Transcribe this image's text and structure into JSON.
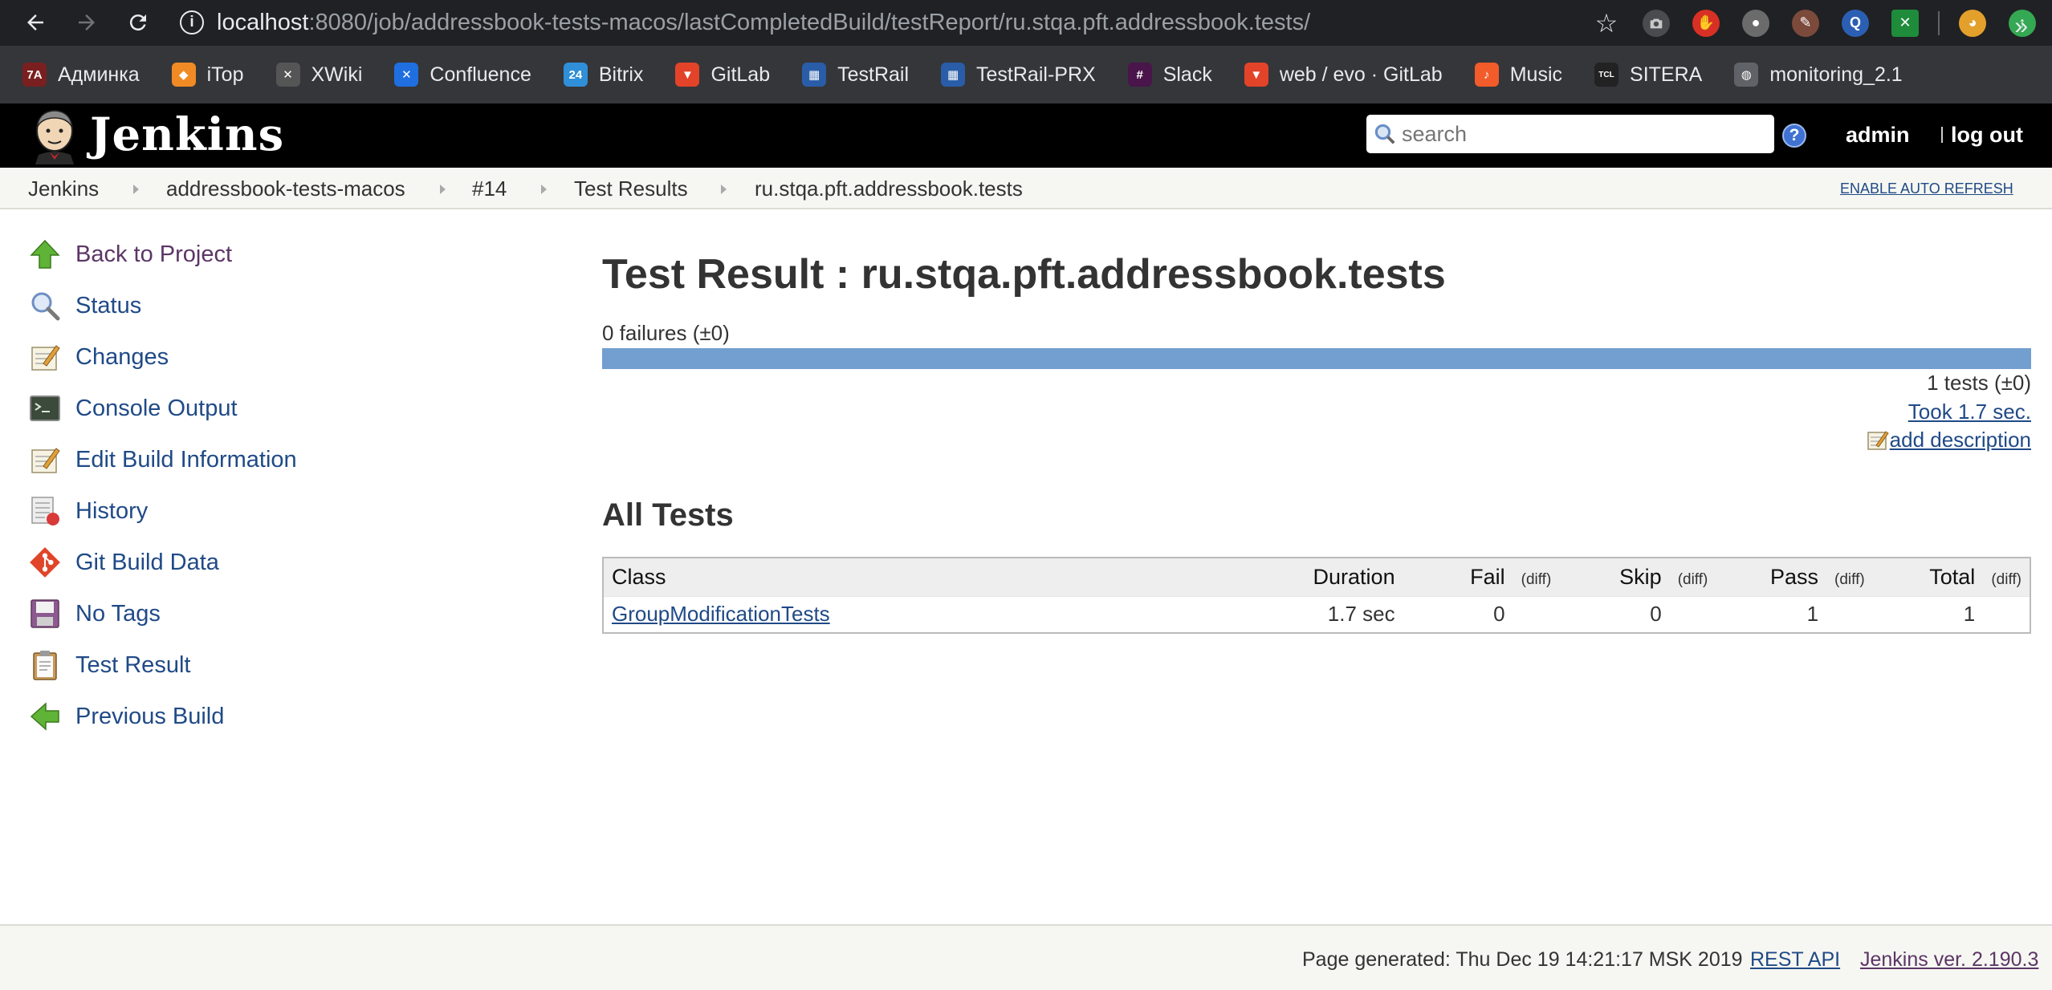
{
  "browser": {
    "url_host": "localhost",
    "url_rest": ":8080/job/addressbook-tests-macos/lastCompletedBuild/testReport/ru.stqa.pft.addressbook.tests/",
    "bookmarks": [
      {
        "label": "Админка",
        "icon": "admin-icon",
        "color": "#7a1f1f",
        "glyph": "7A"
      },
      {
        "label": "iTop",
        "icon": "itop-icon",
        "color": "#f08a24",
        "glyph": "◆"
      },
      {
        "label": "XWiki",
        "icon": "xwiki-icon",
        "color": "#555555",
        "glyph": "✕"
      },
      {
        "label": "Confluence",
        "icon": "confluence-icon",
        "color": "#1f6fe0",
        "glyph": "✕"
      },
      {
        "label": "Bitrix",
        "icon": "bitrix-icon",
        "color": "#2f8fd8",
        "glyph": "24"
      },
      {
        "label": "GitLab",
        "icon": "gitlab-icon",
        "color": "#e24329",
        "glyph": "▼"
      },
      {
        "label": "TestRail",
        "icon": "testrail-icon",
        "color": "#2a5da8",
        "glyph": "▦"
      },
      {
        "label": "TestRail-PRX",
        "icon": "testrail-icon",
        "color": "#2a5da8",
        "glyph": "▦"
      },
      {
        "label": "Slack",
        "icon": "slack-icon",
        "color": "#4a154b",
        "glyph": "#"
      },
      {
        "label": "web / evo · GitLab",
        "icon": "gitlab-icon",
        "color": "#e24329",
        "glyph": "▼"
      },
      {
        "label": "Music",
        "icon": "music-icon",
        "color": "#f25b2a",
        "glyph": "♪"
      },
      {
        "label": "SITERA",
        "icon": "sitera-icon",
        "color": "#222222",
        "glyph": "TCL"
      },
      {
        "label": "monitoring_2.1",
        "icon": "globe-icon",
        "color": "#5f6368",
        "glyph": "◍"
      }
    ]
  },
  "header": {
    "title": "Jenkins",
    "search_placeholder": "search",
    "help": "?",
    "user": "admin",
    "logout": "log out"
  },
  "breadcrumbs": [
    "Jenkins",
    "addressbook-tests-macos",
    "#14",
    "Test Results",
    "ru.stqa.pft.addressbook.tests"
  ],
  "auto_refresh": "ENABLE AUTO REFRESH",
  "sidebar": {
    "items": [
      {
        "label": "Back to Project",
        "icon": "up-arrow-icon"
      },
      {
        "label": "Status",
        "icon": "magnifier-icon"
      },
      {
        "label": "Changes",
        "icon": "notepad-icon"
      },
      {
        "label": "Console Output",
        "icon": "terminal-icon"
      },
      {
        "label": "Edit Build Information",
        "icon": "notepad-icon"
      },
      {
        "label": "History",
        "icon": "history-icon"
      },
      {
        "label": "Git Build Data",
        "icon": "git-icon"
      },
      {
        "label": "No Tags",
        "icon": "floppy-icon"
      },
      {
        "label": "Test Result",
        "icon": "clipboard-icon"
      },
      {
        "label": "Previous Build",
        "icon": "left-arrow-icon"
      }
    ]
  },
  "main": {
    "title": "Test Result : ru.stqa.pft.addressbook.tests",
    "failures": "0 failures (±0)",
    "pass_fraction": 1.0,
    "tests_summary": "1 tests (±0)",
    "took": "Took 1.7 sec.",
    "add_description": "add description",
    "all_tests_heading": "All Tests",
    "table": {
      "headers": {
        "class": "Class",
        "duration": "Duration",
        "fail": "Fail",
        "skip": "Skip",
        "pass": "Pass",
        "total": "Total",
        "diff": "(diff)"
      },
      "rows": [
        {
          "class": "GroupModificationTests",
          "duration": "1.7 sec",
          "fail": "0",
          "fail_diff": "",
          "skip": "0",
          "skip_diff": "",
          "pass": "1",
          "pass_diff": "",
          "total": "1",
          "total_diff": ""
        }
      ]
    }
  },
  "footer": {
    "generated": "Page generated: Thu Dec 19 14:21:17 MSK 2019",
    "rest_api": "REST API",
    "version": "Jenkins ver. 2.190.3"
  }
}
